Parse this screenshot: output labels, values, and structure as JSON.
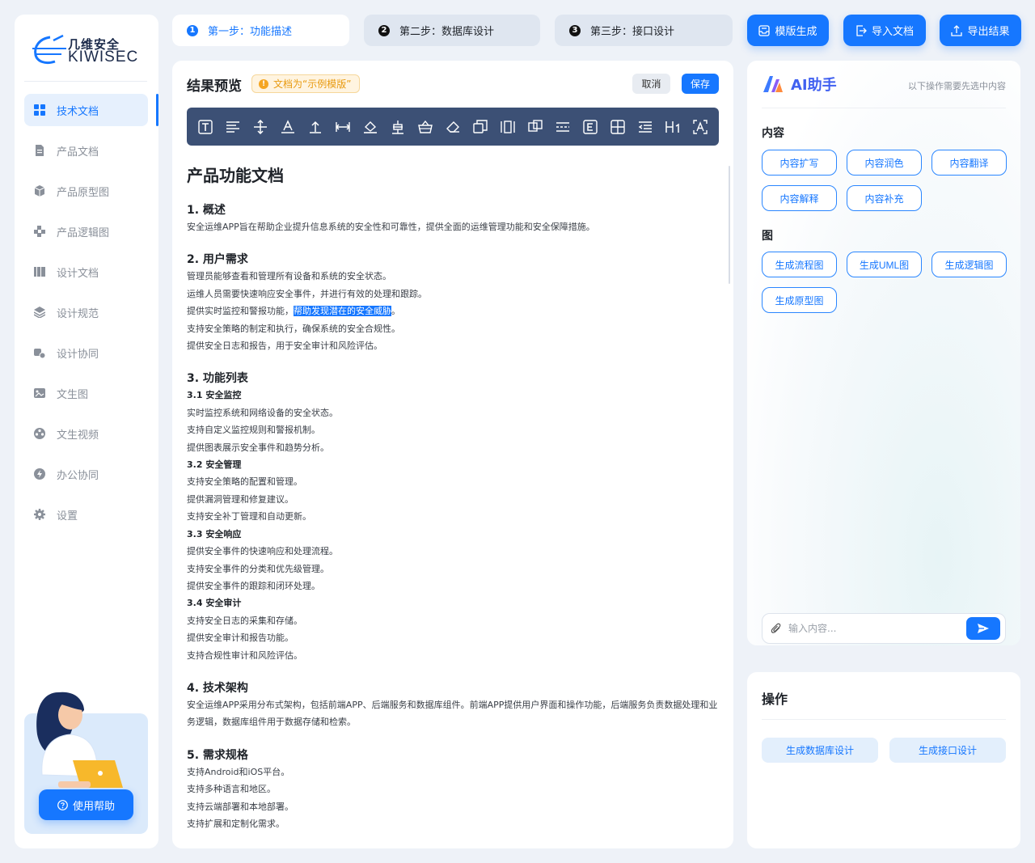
{
  "brand": {
    "name_cn": "几维安全",
    "name_en": "KIWISEC"
  },
  "sidebar": {
    "items": [
      {
        "label": "技术文档",
        "icon": "grid-icon",
        "active": true
      },
      {
        "label": "产品文档",
        "icon": "document-icon",
        "active": false
      },
      {
        "label": "产品原型图",
        "icon": "cube-icon",
        "active": false
      },
      {
        "label": "产品逻辑图",
        "icon": "puzzle-icon",
        "active": false
      },
      {
        "label": "设计文档",
        "icon": "book-icon",
        "active": false
      },
      {
        "label": "设计规范",
        "icon": "layers-icon",
        "active": false
      },
      {
        "label": "设计协同",
        "icon": "collab-icon",
        "active": false
      },
      {
        "label": "文生图",
        "icon": "image-icon",
        "active": false
      },
      {
        "label": "文生视频",
        "icon": "film-reel-icon",
        "active": false
      },
      {
        "label": "办公协同",
        "icon": "lightning-icon",
        "active": false
      },
      {
        "label": "设置",
        "icon": "gear-icon",
        "active": false
      }
    ],
    "help_label": "使用帮助"
  },
  "steps": [
    {
      "num": "1",
      "label": "第一步：功能描述",
      "active": true
    },
    {
      "num": "2",
      "label": "第二步：数据库设计",
      "active": false
    },
    {
      "num": "3",
      "label": "第三步：接口设计",
      "active": false
    }
  ],
  "top_actions": {
    "template": "模版生成",
    "import": "导入文档",
    "export": "导出结果"
  },
  "editor": {
    "title": "结果预览",
    "tag": "文档为“示例模版”",
    "cancel": "取消",
    "save": "保存",
    "toolbar": [
      "text-box-icon",
      "align-left-icon",
      "line-height-icon",
      "font-color-icon",
      "text-top-icon",
      "text-width-icon",
      "fill-color-icon",
      "baseline-icon",
      "basket-icon",
      "eraser-icon",
      "copy-icon",
      "columns-icon",
      "group-icon",
      "divider-icon",
      "e-box-icon",
      "table-icon",
      "indent-icon",
      "heading1-icon",
      "ocr-icon"
    ]
  },
  "doc": {
    "title": "产品功能文档",
    "s1": {
      "h": "1. 概述",
      "p": [
        "安全运维APP旨在帮助企业提升信息系统的安全性和可靠性，提供全面的运维管理功能和安全保障措施。"
      ]
    },
    "s2": {
      "h": "2. 用户需求",
      "p1": "管理员能够查看和管理所有设备和系统的安全状态。",
      "p2": "运维人员需要快速响应安全事件，并进行有效的处理和跟踪。",
      "p3a": "提供实时监控和警报功能，",
      "p3b": "帮助发现潜在的安全威胁",
      "p3c": "。",
      "p4": "支持安全策略的制定和执行，确保系统的安全合规性。",
      "p5": "提供安全日志和报告，用于安全审计和风险评估。"
    },
    "s3": {
      "h": "3. 功能列表",
      "subs": [
        {
          "h": "3.1 安全监控",
          "p": [
            "实时监控系统和网络设备的安全状态。",
            "支持自定义监控规则和警报机制。",
            "提供图表展示安全事件和趋势分析。"
          ]
        },
        {
          "h": "3.2 安全管理",
          "p": [
            "支持安全策略的配置和管理。",
            "提供漏洞管理和修复建议。",
            "支持安全补丁管理和自动更新。"
          ]
        },
        {
          "h": "3.3 安全响应",
          "p": [
            "提供安全事件的快速响应和处理流程。",
            "支持安全事件的分类和优先级管理。",
            "提供安全事件的跟踪和闭环处理。"
          ]
        },
        {
          "h": "3.4 安全审计",
          "p": [
            "支持安全日志的采集和存储。",
            "提供安全审计和报告功能。",
            "支持合规性审计和风险评估。"
          ]
        }
      ]
    },
    "s4": {
      "h": "4. 技术架构",
      "p": [
        "安全运维APP采用分布式架构，包括前端APP、后端服务和数据库组件。前端APP提供用户界面和操作功能，后端服务负责数据处理和业务逻辑，数据库组件用于数据存储和检索。"
      ]
    },
    "s5": {
      "h": "5. 需求规格",
      "p": [
        "支持Android和iOS平台。",
        "支持多种语言和地区。",
        "支持云端部署和本地部署。",
        "支持扩展和定制化需求。"
      ]
    }
  },
  "ai": {
    "title": "AI助手",
    "hint": "以下操作需要先选中内容",
    "content_label": "内容",
    "content_actions": [
      "内容扩写",
      "内容润色",
      "内容翻译",
      "内容解释",
      "内容补充"
    ],
    "diagram_label": "图",
    "diagram_actions": [
      "生成流程图",
      "生成UML图",
      "生成逻辑图",
      "生成原型图"
    ],
    "input_placeholder": "输入内容..."
  },
  "ops": {
    "title": "操作",
    "db_design": "生成数据库设计",
    "api_design": "生成接口设计"
  },
  "colors": {
    "accent": "#1677ff",
    "toolbar": "#3c5075",
    "tag_bg": "#fff4e0"
  }
}
